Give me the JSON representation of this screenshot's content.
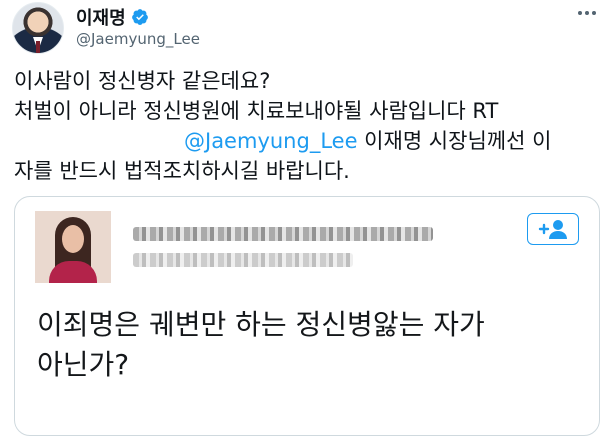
{
  "author": {
    "display_name": "이재명",
    "handle": "@Jaemyung_Lee",
    "verified": true,
    "avatar": "profile-photo"
  },
  "tweet": {
    "line1": "이사람이 정신병자 같은데요?",
    "line2": "처벌이 아니라 정신병원에 치료보내야될 사람입니다 RT",
    "mention": "@Jaemyung_Lee",
    "line3_rest": " 이재명 시장님께선 이",
    "line4": "자를 반드시 법적조치하시길 바랍니다."
  },
  "quote": {
    "avatar": "blurred-profile-photo",
    "follow_icon": "add-user-icon",
    "text_line1": "이죄명은 궤변만 하는 정신병앓는 자가",
    "text_line2": "아닌가?"
  },
  "colors": {
    "accent": "#1d9bf0",
    "text": "#0f1419",
    "muted": "#536471",
    "border": "#cfd9de"
  }
}
